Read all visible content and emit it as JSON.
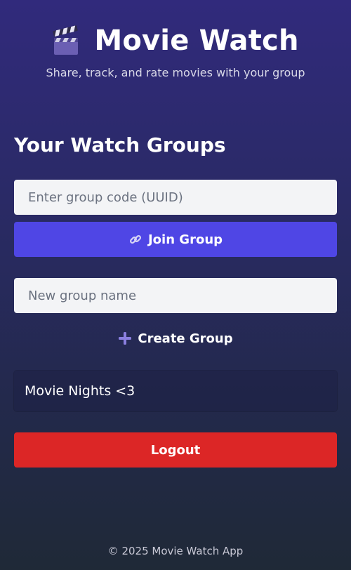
{
  "header": {
    "title": "Movie Watch",
    "subtitle": "Share, track, and rate movies with your group"
  },
  "groups_section": {
    "heading": "Your Watch Groups",
    "join": {
      "placeholder": "Enter group code (UUID)",
      "value": "",
      "button_label": "Join Group",
      "button_icon": "link-icon"
    },
    "create": {
      "placeholder": "New group name",
      "value": "",
      "button_label": "Create Group",
      "button_icon": "plus-icon"
    },
    "groups": [
      {
        "name": "Movie Nights <3"
      }
    ]
  },
  "logout_label": "Logout",
  "footer": "© 2025 Movie Watch App",
  "colors": {
    "join_button": "#4f46e5",
    "logout_button": "#dc2626",
    "input_background": "#f3f4f6"
  }
}
